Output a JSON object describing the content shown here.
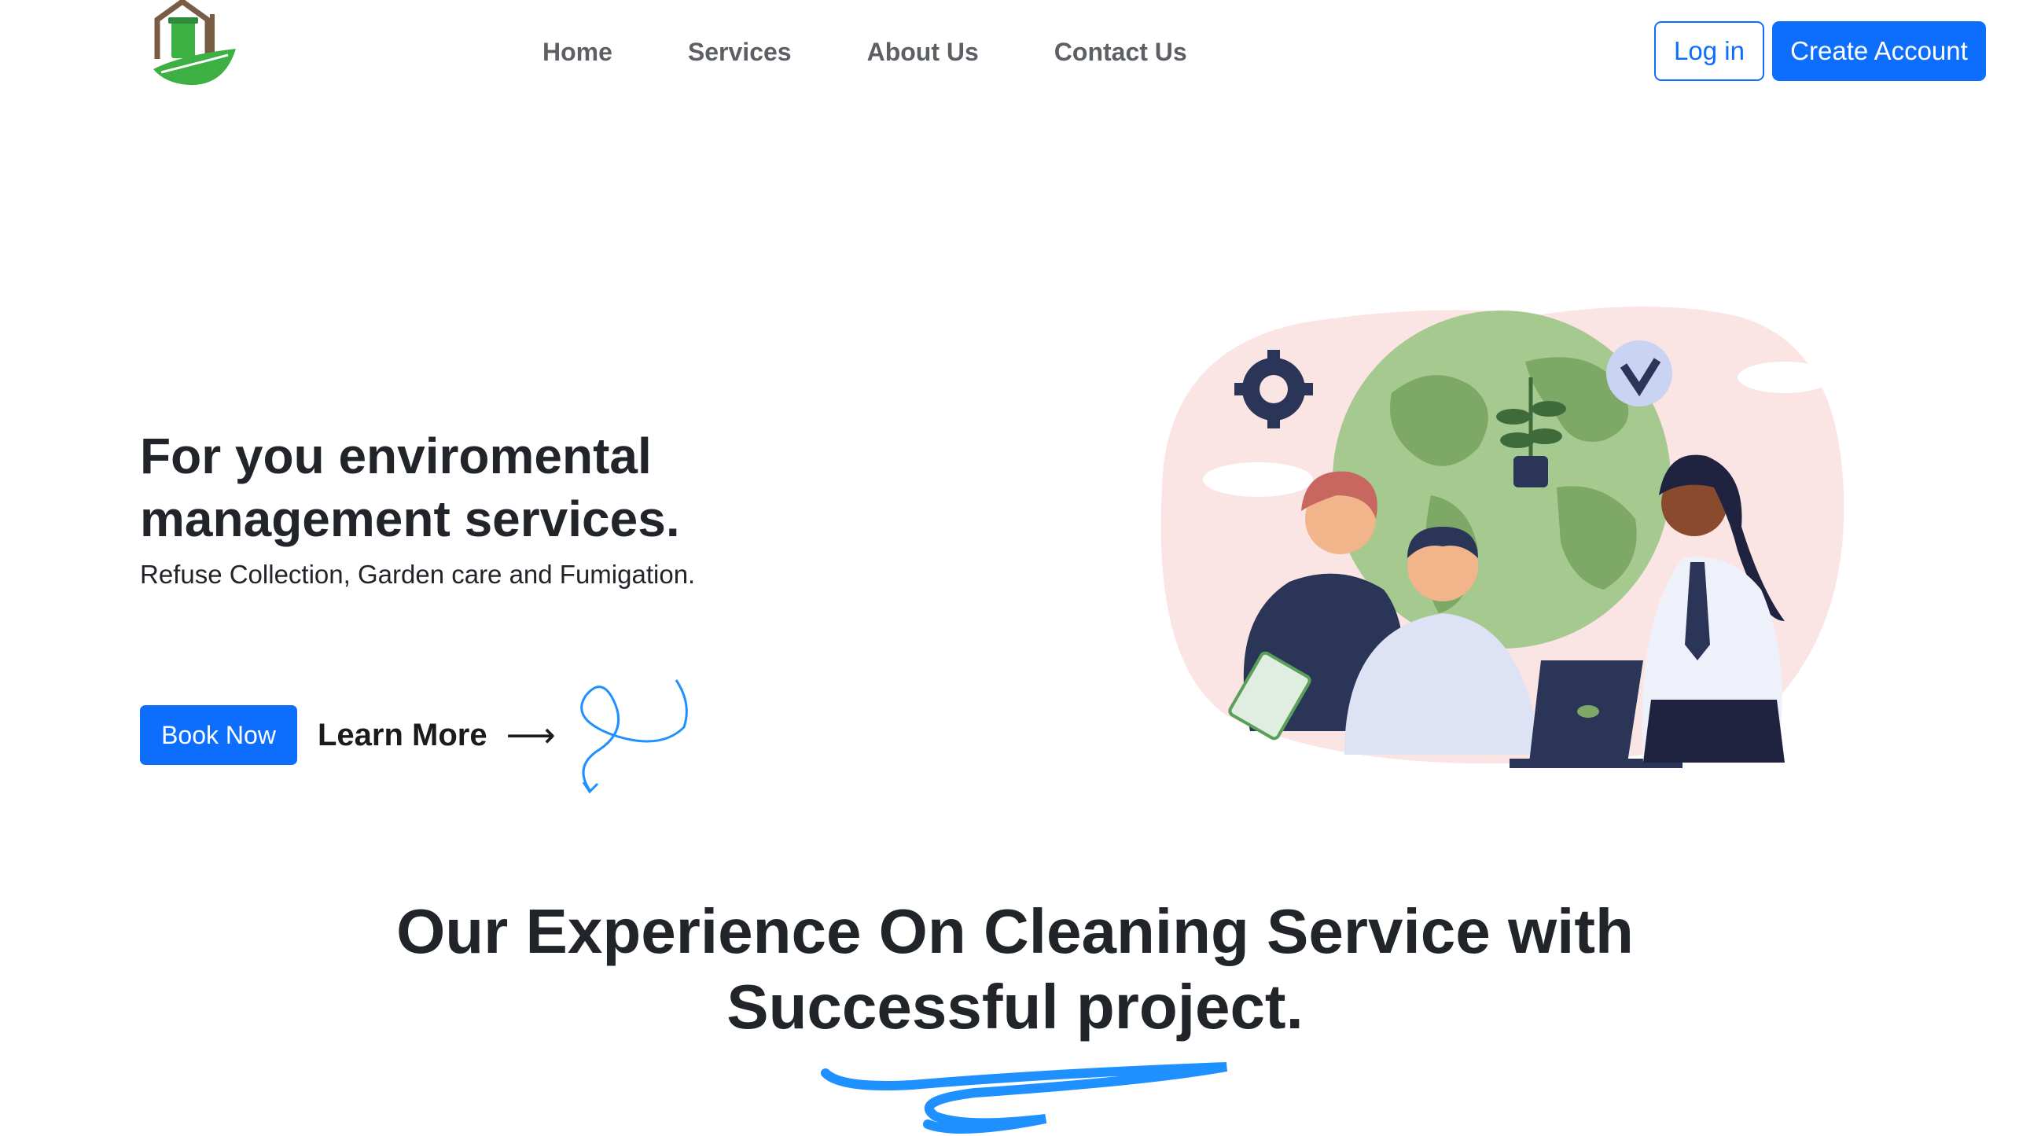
{
  "nav": {
    "links": [
      "Home",
      "Services",
      "About Us",
      "Contact Us"
    ],
    "login_label": "Log in",
    "create_account_label": "Create Account"
  },
  "hero": {
    "title": "For you enviromental management services.",
    "subtitle": "Refuse Collection, Garden care and Fumigation.",
    "book_label": "Book Now",
    "learn_more_label": "Learn More",
    "learn_more_arrow": "⟶"
  },
  "section": {
    "title": "Our Experience On Cleaning Service with Successful project."
  },
  "colors": {
    "primary": "#0d6efd",
    "nav_text": "#5c5f63",
    "heading": "#212529",
    "logo_green": "#3cb043",
    "logo_brown": "#7a5c45",
    "swirl_blue": "#1e90ff"
  },
  "icons": [
    "logo-icon",
    "arrow-right-icon",
    "squiggle-decoration",
    "gear-icon",
    "check-badge-icon",
    "underline-swirl-decoration"
  ]
}
